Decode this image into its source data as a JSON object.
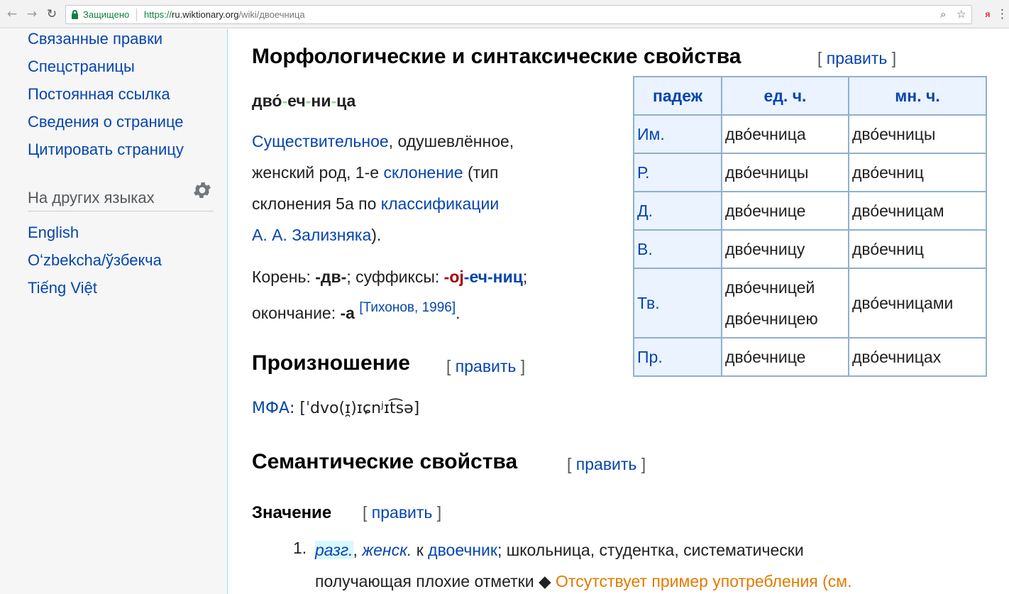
{
  "browser": {
    "secure_label": "Защищено",
    "url_proto": "https://",
    "url_host": "ru.wiktionary.org",
    "url_path": "/wiki/двоечница",
    "ext_label": "я"
  },
  "sidebar": {
    "links": [
      "Связанные правки",
      "Спецстраницы",
      "Постоянная ссылка",
      "Сведения о странице",
      "Цитировать страницу"
    ],
    "lang_heading": "На других языках",
    "languages": [
      "English",
      "Oʻzbekcha/ўзбекча",
      "Tiếng Việt"
    ]
  },
  "edit_label": "править",
  "morph": {
    "heading": "Морфологические и синтаксические свойства",
    "syllables": [
      "дво́",
      "еч",
      "ни",
      "ца"
    ],
    "pos_link": "Существительное",
    "line1_rest": ", одушевлённое,",
    "line2_a": "женский род, 1-е ",
    "decl_link": "склонение",
    "line2_b": " (тип",
    "line3_a": "склонения 5a по ",
    "class_link": "классификации",
    "zal_link": "А. А. Зализняка",
    "line4_b": ").",
    "root_label": "Корень: ",
    "root": "-дв-",
    "suffix_label": "; суффиксы: ",
    "suffix1": "-oj",
    "suffix2": "-еч-ниц",
    "semicolon": ";",
    "ending_label": "окончание: ",
    "ending": "-а",
    "ref": "[Тихонов, 1996]",
    "period": "."
  },
  "table": {
    "headers": [
      "падеж",
      "ед. ч.",
      "мн. ч."
    ],
    "rows": [
      {
        "case": "Им.",
        "sg": "дво́ечница",
        "pl": "дво́ечницы"
      },
      {
        "case": "Р.",
        "sg": "дво́ечницы",
        "pl": "дво́ечниц"
      },
      {
        "case": "Д.",
        "sg": "дво́ечнице",
        "pl": "дво́ечницам"
      },
      {
        "case": "В.",
        "sg": "дво́ечницу",
        "pl": "дво́ечниц"
      },
      {
        "case": "Тв.",
        "sg": "дво́ечницей",
        "sg2": "дво́ечницею",
        "pl": "дво́ечницами"
      },
      {
        "case": "Пр.",
        "sg": "дво́ечнице",
        "pl": "дво́ечницах"
      }
    ]
  },
  "pron": {
    "heading": "Произношение",
    "ipa_link": "МФА",
    "ipa": ": [ˈdvo(ɪ̯)ɪɕnʲɪt͡sə]"
  },
  "sem": {
    "heading": "Семантические свойства",
    "meaning_heading": "Значение",
    "item_number": "1.",
    "tag1": "разг.",
    "comma": ", ",
    "tag2": "женск.",
    "k": " к ",
    "base_link": "двоечник",
    "def_rest": "; школьница, студентка, систематически",
    "def_line2": "получающая плохие отметки ",
    "diamond": "◆",
    "missing": " Отсутствует пример употребления (см."
  }
}
